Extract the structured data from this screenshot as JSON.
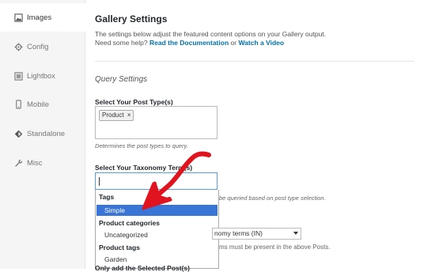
{
  "sidebar": {
    "items": [
      {
        "label": "Images",
        "icon": "image-icon"
      },
      {
        "label": "Config",
        "icon": "gear-icon"
      },
      {
        "label": "Lightbox",
        "icon": "lightbox-icon"
      },
      {
        "label": "Mobile",
        "icon": "mobile-icon"
      },
      {
        "label": "Standalone",
        "icon": "standalone-icon"
      },
      {
        "label": "Misc",
        "icon": "wrench-icon"
      }
    ],
    "active_index": 0
  },
  "main": {
    "title": "Gallery Settings",
    "description": "The settings below adjust the featured content options on your Gallery output.",
    "help_prefix": "Need some help?",
    "doc_link": "Read the Documentation",
    "or_text": "or",
    "video_link": "Watch a Video",
    "section_title": "Query Settings",
    "post_type": {
      "label": "Select Your Post Type(s)",
      "selected_chip": "Product",
      "chip_remove": "×",
      "help": "Determines the post types to query."
    },
    "taxonomy": {
      "label": "Select Your Taxonomy Term(s)",
      "help_partial": "be queried based on post type selection."
    },
    "dropdown": {
      "groups": [
        {
          "label": "Tags",
          "options": [
            "Simple"
          ]
        },
        {
          "label": "Product categories",
          "options": [
            "Uncategorized"
          ]
        },
        {
          "label": "Product tags",
          "options": [
            "Garden"
          ]
        }
      ],
      "highlighted": "Simple"
    },
    "terms_relation": {
      "select_value": "nomy terms (IN)",
      "help_partial": "ms must be present in the above Posts."
    },
    "bottom_label_partial": "Only add the Selected Post(s)"
  },
  "colors": {
    "accent": "#0073aa",
    "highlight": "#3875d7",
    "annotation_arrow": "#e0141e"
  }
}
